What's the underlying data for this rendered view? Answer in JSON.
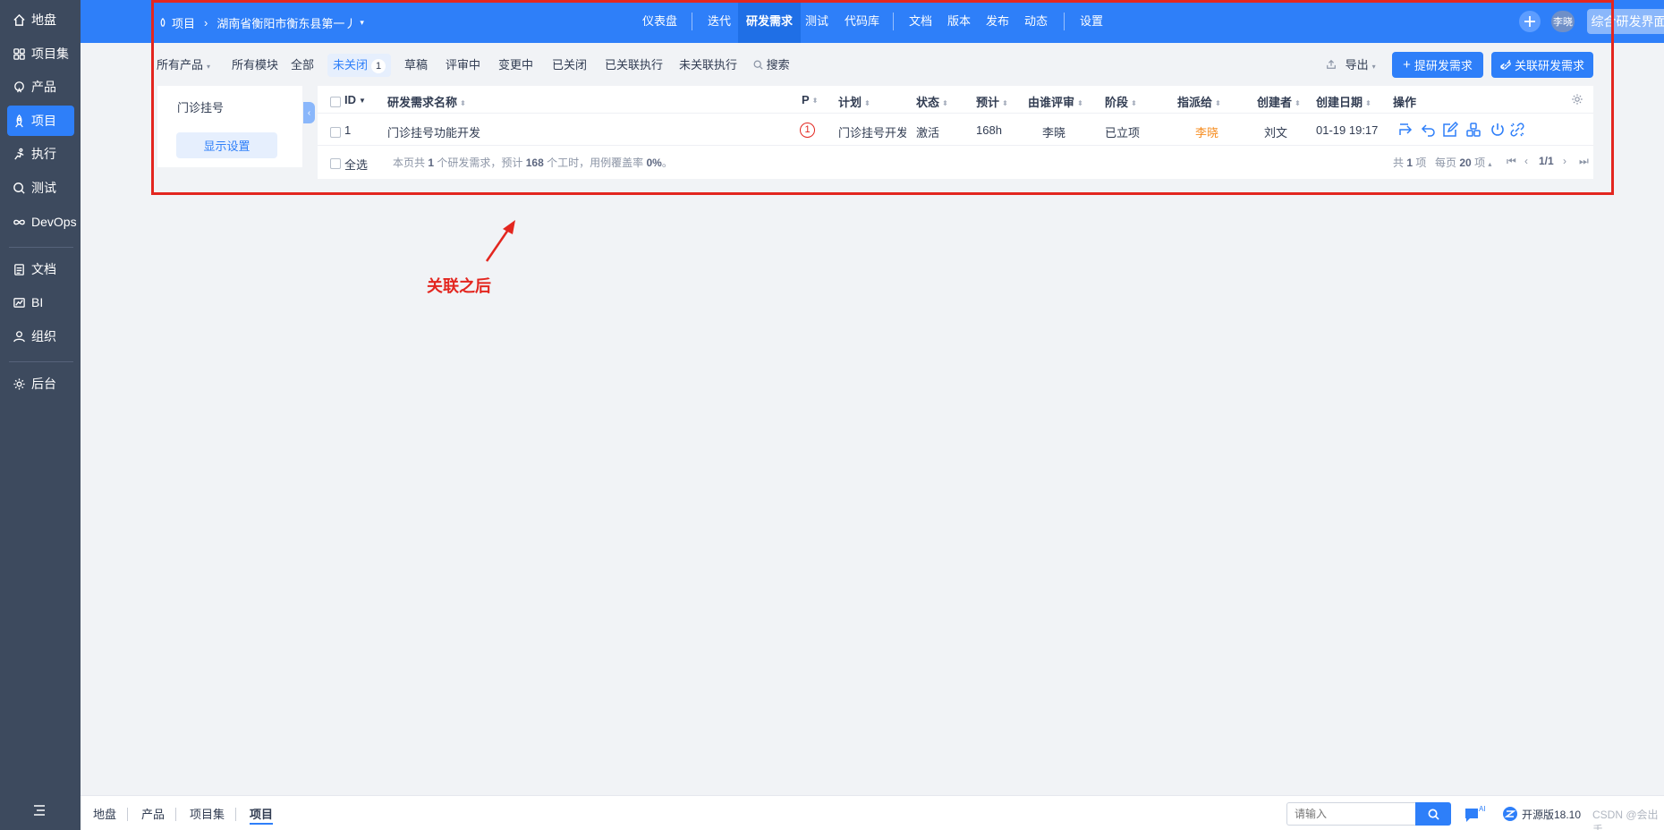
{
  "sidebar": {
    "items": [
      {
        "label": "地盘",
        "icon": "home-icon"
      },
      {
        "label": "项目集",
        "icon": "grid-icon"
      },
      {
        "label": "产品",
        "icon": "product-icon"
      },
      {
        "label": "项目",
        "icon": "project-rocket-icon",
        "active": true
      },
      {
        "label": "执行",
        "icon": "run-icon"
      },
      {
        "label": "测试",
        "icon": "test-icon"
      },
      {
        "label": "DevOps",
        "icon": "infinity-icon"
      },
      {
        "label": "文档",
        "icon": "doc-icon"
      },
      {
        "label": "BI",
        "icon": "bi-icon"
      },
      {
        "label": "组织",
        "icon": "org-icon"
      },
      {
        "label": "后台",
        "icon": "settings-icon"
      }
    ]
  },
  "header": {
    "breadcrumb_root": "项目",
    "breadcrumb_project": "湖南省衡阳市衡东县第一丿",
    "nav": [
      "仪表盘",
      "迭代",
      "研发需求",
      "测试",
      "代码库",
      "文档",
      "版本",
      "发布",
      "动态",
      "设置"
    ],
    "active_nav": "研发需求",
    "user": "李晓",
    "switch_button": "综合研发界面"
  },
  "filters": {
    "product": "所有产品",
    "module": "所有模块",
    "tabs": [
      "全部",
      "未关闭",
      "草稿",
      "评审中",
      "变更中",
      "已关闭",
      "已关联执行",
      "未关联执行"
    ],
    "active_tab": "未关闭",
    "active_count": "1",
    "search": "搜索",
    "export": "导出",
    "create_button": "提研发需求",
    "link_button": "关联研发需求"
  },
  "module_panel": {
    "module_name": "门诊挂号",
    "settings_button": "显示设置"
  },
  "table": {
    "columns": [
      "ID",
      "研发需求名称",
      "P",
      "计划",
      "状态",
      "预计",
      "由谁评审",
      "阶段",
      "指派给",
      "创建者",
      "创建日期",
      "操作"
    ],
    "rows": [
      {
        "id": "1",
        "name": "门诊挂号功能开发",
        "priority": "1",
        "plan": "门诊挂号开发计",
        "status": "激活",
        "estimate": "168h",
        "reviewer": "李晓",
        "stage": "已立项",
        "assignee": "李晓",
        "creator": "刘文",
        "created": "01-19 19:17"
      }
    ],
    "select_all": "全选",
    "summary_prefix": "本页共",
    "summary_count": "1",
    "summary_middle": "个研发需求，预计",
    "summary_hours": "168",
    "summary_middle2": "个工时，用例覆盖率",
    "summary_coverage": "0%",
    "summary_suffix": "。",
    "pager": {
      "total_prefix": "共",
      "total": "1",
      "total_suffix": "项",
      "per_page_prefix": "每页",
      "per_page": "20",
      "per_page_suffix": "项",
      "page": "1/1"
    }
  },
  "annotation": {
    "text": "关联之后",
    "color": "#e3261f"
  },
  "bottom_bar": {
    "tabs": [
      "地盘",
      "产品",
      "项目集",
      "项目"
    ],
    "active_tab": "项目",
    "search_placeholder": "请输入",
    "version": "开源版18.10",
    "watermark": "CSDN @会出手"
  },
  "colors": {
    "primary": "#2e7ff9",
    "sidebar": "#3d4a5e",
    "priority": "#e3261f",
    "assignee": "#f68c1f"
  }
}
